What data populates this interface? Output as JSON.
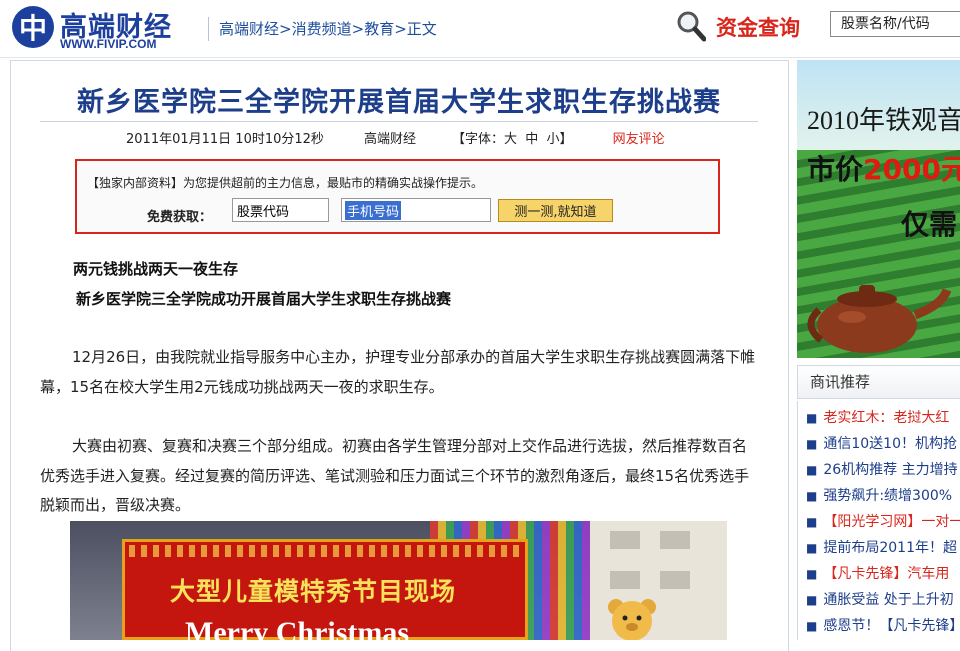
{
  "header": {
    "logo_glyph": "中",
    "logo_name": "高端财经",
    "logo_url": "WWW.FIVIP.COM",
    "breadcrumb": [
      "高端财经",
      "消费频道",
      "教育",
      "正文"
    ],
    "breadcrumb_sep": ">",
    "fund_query": "资金查询",
    "stock_placeholder": "股票名称/代码"
  },
  "article": {
    "title": "新乡医学院三全学院开展首届大学生求职生存挑战赛",
    "meta": {
      "datetime": "2011年01月11日  10时10分12秒",
      "source": "高端财经",
      "font_label": "【字体：",
      "font_sizes": [
        "大",
        "中",
        "小"
      ],
      "font_close": "】",
      "comment": "网友评论"
    },
    "promo": {
      "text": "【独家内部资料】为您提供超前的主力信息，最贴市的精确实战操作提示。",
      "free_label": "免费获取：",
      "stock_value": "股票代码",
      "phone_value": "手机号码",
      "button": "测一测,就知道"
    },
    "subheads": [
      "两元钱挑战两天一夜生存",
      "新乡医学院三全学院成功开展首届大学生求职生存挑战赛"
    ],
    "paragraphs": [
      "12月26日，由我院就业指导服务中心主办，护理专业分部承办的首届大学生求职生存挑战赛圆满落下帷幕，15名在校大学生用2元钱成功挑战两天一夜的求职生存。",
      "大赛由初赛、复赛和决赛三个部分组成。初赛由各学生管理分部对上交作品进行选拔，然后推荐数百名优秀选手进入复赛。经过复赛的简历评选、笔试测验和压力面试三个环节的激烈角逐后，最终15名优秀选手脱颖而出，晋级决赛。"
    ],
    "photo": {
      "banner_title": "大型儿童模特秀节目现场",
      "banner_sub": "Merry Christmas"
    }
  },
  "sidebar": {
    "ad": {
      "title": "2010年铁观音",
      "price_prefix": "市价",
      "price_value": "2000元",
      "only": "仅需"
    },
    "header": "商讯推荐",
    "items": [
      {
        "text": "老实红木：老挝大红",
        "color": "red"
      },
      {
        "text": "通信10送10！机构抢",
        "color": "blue"
      },
      {
        "text": "26机构推荐 主力增持",
        "color": "blue"
      },
      {
        "text": "强势飙升:绩增300%",
        "color": "blue"
      },
      {
        "text": "【阳光学习网】一对一",
        "color": "red"
      },
      {
        "text": "提前布局2011年！超",
        "color": "blue"
      },
      {
        "text": "【凡卡先锋】汽车用",
        "color": "red"
      },
      {
        "text": "通胀受益 处于上升初",
        "color": "blue"
      },
      {
        "text": "感恩节！【凡卡先锋】",
        "color": "blue"
      }
    ]
  },
  "colors": {
    "brand_blue": "#1d3f9e",
    "accent_red": "#d9261c",
    "link_blue": "#1d4e9e"
  }
}
